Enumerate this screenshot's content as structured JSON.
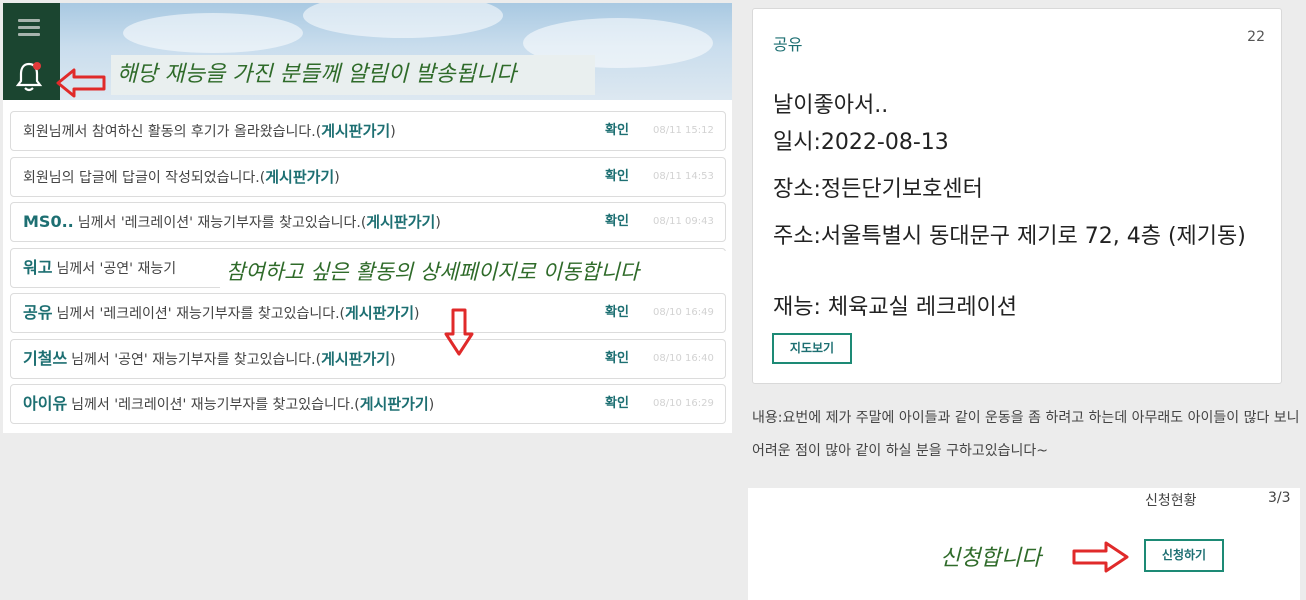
{
  "header": {
    "menu_icon": "menu-icon",
    "bell_icon": "bell-icon",
    "annotation": "해당 재능을 가진 분들께 알림이 발송됩니다"
  },
  "notifications": [
    {
      "name": "",
      "text": "회원님께서 참여하신 활동의 후기가 올라왔습니다.(",
      "link": "게시판가기",
      "close": ")",
      "confirm": "확인",
      "time": "08/11 15:12"
    },
    {
      "name": "",
      "text": "회원님의 답글에 답글이 작성되었습니다.(",
      "link": "게시판가기",
      "close": ")",
      "confirm": "확인",
      "time": "08/11 14:53"
    },
    {
      "name": "MS0..",
      "text": "님께서 '레크레이션' 재능기부자를 찾고있습니다.(",
      "link": "게시판가기",
      "close": ")",
      "confirm": "확인",
      "time": "08/11 09:43"
    },
    {
      "name": "워고",
      "text": "님께서 '공연' 재능기",
      "link": "",
      "close": "",
      "confirm": "",
      "time": ""
    },
    {
      "name": "공유",
      "text": "님께서 '레크레이션' 재능기부자를 찾고있습니다.(",
      "link": "게시판가기",
      "close": ")",
      "confirm": "확인",
      "time": "08/10 16:49"
    },
    {
      "name": "기철쓰",
      "text": "님께서 '공연' 재능기부자를 찾고있습니다.(",
      "link": "게시판가기",
      "close": ")",
      "confirm": "확인",
      "time": "08/10 16:40"
    },
    {
      "name": "아이유",
      "text": "님께서 '레크레이션' 재능기부자를 찾고있습니다.(",
      "link": "게시판가기",
      "close": ")",
      "confirm": "확인",
      "time": "08/10 16:29"
    }
  ],
  "annotation_mid": "참여하고 싶은 활동의 상세페이지로 이동합니다",
  "detail": {
    "category": "공유",
    "count": "22",
    "title": "날이좋아서..",
    "date": "일시:2022-08-13",
    "place": "장소:정든단기보호센터",
    "address": "주소:서울특별시 동대문구 제기로 72, 4층 (제기동)",
    "talent": "재능: 체육교실 레크레이션",
    "map_button": "지도보기",
    "content": "내용:요번에 제가 주말에 아이들과 같이 운동을 좀 하려고 하는데 아무래도 아이들이 많다 보니 어려운 점이 많아 같이 하실 분을 구하고있습니다~",
    "status_label": "신청현황",
    "status_value": "3/3",
    "apply_button": "신청하기",
    "annotation_apply": "신청합니다"
  },
  "colors": {
    "accent": "#1d6f72",
    "header_bar": "#1b4530",
    "annotation": "#2f6b2a",
    "arrow": "#e02a2a"
  }
}
